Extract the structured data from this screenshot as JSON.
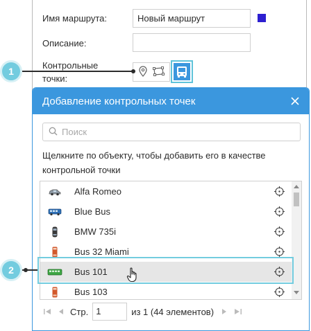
{
  "form": {
    "route_name_label": "Имя маршрута:",
    "route_name_value": "Новый маршрут",
    "description_label": "Описание:",
    "description_value": "",
    "checkpoints_label_line1": "Контрольные",
    "checkpoints_label_line2": "точки:",
    "route_color": "#2d1fd0"
  },
  "callouts": {
    "one": "1",
    "two": "2"
  },
  "dialog": {
    "title": "Добавление контрольных точек",
    "search_placeholder": "Поиск",
    "hint": "Щелкните по объекту, чтобы добавить его в качестве контрольной точки",
    "units": [
      {
        "name": "Alfa Romeo",
        "icon": "car-icon"
      },
      {
        "name": "Blue Bus",
        "icon": "bus-icon"
      },
      {
        "name": "BMW 735i",
        "icon": "car-topview-icon"
      },
      {
        "name": "Bus 32 Miami",
        "icon": "bus-topview-icon"
      },
      {
        "name": "Bus 101",
        "icon": "green-bus-icon",
        "selected": true
      },
      {
        "name": "Bus 103",
        "icon": "bus-topview-icon"
      }
    ],
    "pager": {
      "page_label": "Стр.",
      "page_value": "1",
      "of_text": "из 1 (44 элементов)"
    }
  },
  "colors": {
    "accent": "#3b97de",
    "callout": "#73ccdf"
  }
}
